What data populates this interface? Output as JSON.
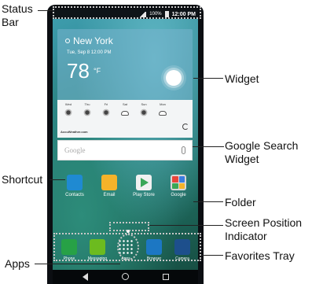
{
  "status_bar": {
    "battery": "100%",
    "time": "12:00 PM"
  },
  "weather": {
    "city": "New York",
    "date": "Tue, Sep 8   12:00",
    "date_suffix": "PM",
    "temp": "78",
    "unit": "°F",
    "forecast": [
      {
        "day": "Wed",
        "icon": "partly-sunny-icon"
      },
      {
        "day": "Thu",
        "icon": "sun-icon"
      },
      {
        "day": "Fri",
        "icon": "sun-icon"
      },
      {
        "day": "Sat",
        "icon": "cloud-icon"
      },
      {
        "day": "Sun",
        "icon": "partly-sunny-icon"
      },
      {
        "day": "Mon",
        "icon": "cloud-icon"
      }
    ],
    "provider": "AccuWeather.com"
  },
  "search": {
    "placeholder": "Google"
  },
  "apps": [
    {
      "label": "Contacts"
    },
    {
      "label": "Email"
    },
    {
      "label": "Play Store"
    },
    {
      "label": "Google"
    }
  ],
  "favorites": [
    {
      "label": "Phone"
    },
    {
      "label": "Messaging"
    },
    {
      "label": "Apps"
    },
    {
      "label": "Browser"
    },
    {
      "label": "Camera"
    }
  ],
  "callouts": {
    "status_bar": "Status\nBar",
    "widget": "Widget",
    "google_search_widget": "Google Search\nWidget",
    "shortcut": "Shortcut",
    "folder": "Folder",
    "screen_position_indicator": "Screen Position\nIndicator",
    "apps": "Apps",
    "favorites_tray": "Favorites Tray"
  }
}
